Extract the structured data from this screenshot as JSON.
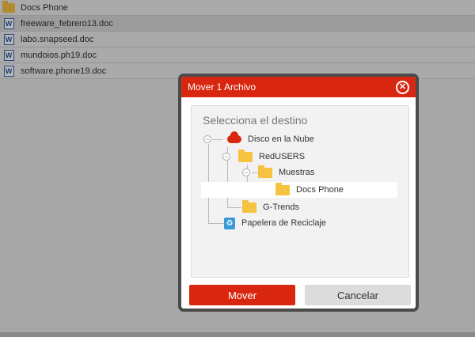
{
  "file_list": [
    {
      "name": "Docs Phone",
      "icon": "folder-icon",
      "selected": false
    },
    {
      "name": "freeware_febrero13.doc",
      "icon": "word-doc-icon",
      "selected": true
    },
    {
      "name": "labo.snapseed.doc",
      "icon": "word-doc-icon",
      "selected": false
    },
    {
      "name": "mundoios.ph19.doc",
      "icon": "word-doc-icon",
      "selected": false
    },
    {
      "name": "software.phone19.doc",
      "icon": "word-doc-icon",
      "selected": false
    }
  ],
  "modal": {
    "title": "Mover 1 Archivo",
    "panel_title": "Selecciona el destino",
    "tree": {
      "cloud": "Disco en la Nube",
      "redusers": "RedUSERS",
      "muestras": "Muestras",
      "docs_phone": "Docs Phone",
      "gtrends": "G-Trends",
      "recycle": "Papelera de Reciclaje"
    },
    "move_label": "Mover",
    "cancel_label": "Cancelar"
  },
  "colors": {
    "accent": "#d9270f",
    "folder": "#f5c242",
    "recycle": "#3b9ad6"
  }
}
